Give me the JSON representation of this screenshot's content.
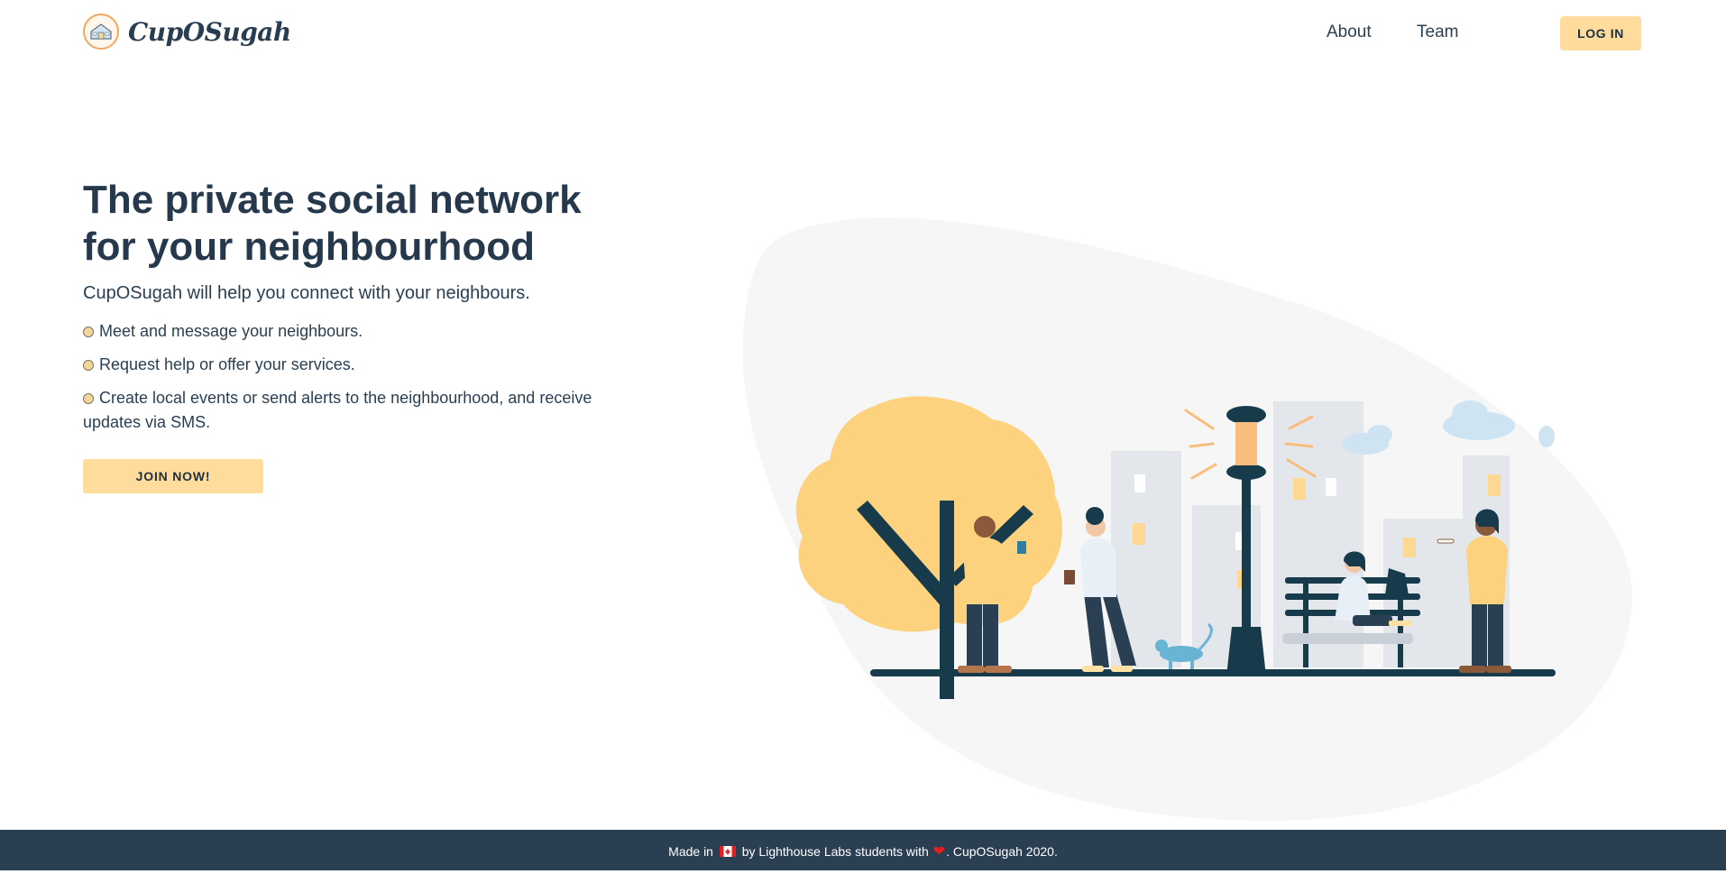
{
  "nav": {
    "brand_name": "CupOSugah",
    "logo_icon": "house-badge-icon",
    "links": [
      "About",
      "Team"
    ],
    "login_label": "LOG IN"
  },
  "hero": {
    "title": "The private social network for your neighbourhood",
    "tagline": "CupOSugah will help you connect with your neighbours.",
    "features": [
      "Meet and message your neighbours.",
      "Request help or offer your services.",
      "Create local events or send alerts to the neighbourhood, and receive updates via SMS."
    ],
    "join_label": "JOIN NOW!"
  },
  "illustration": {
    "icon": "neighbourhood-park-illustration"
  },
  "footer": {
    "part1": "Made in",
    "part2": "by Lighthouse Labs students with",
    "part3": ". CupOSugah 2020.",
    "flag_icon": "canada-flag-icon",
    "heart_icon": "heart-icon"
  },
  "colors": {
    "primary_text": "#26394c",
    "accent_button": "#ffdb9c",
    "footer_bg": "#2a3f52",
    "logo_ring": "#f0a860"
  }
}
